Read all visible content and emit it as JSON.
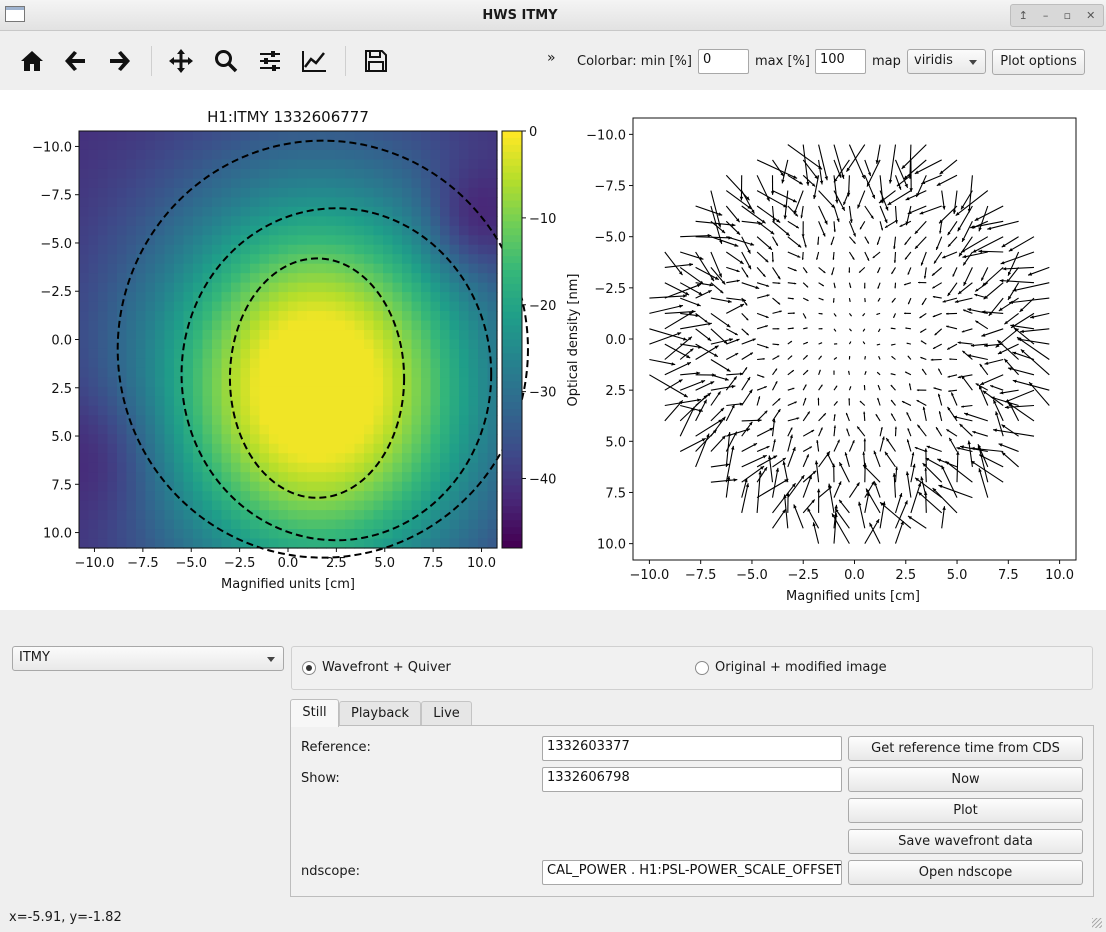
{
  "window": {
    "title": "HWS ITMY",
    "controls": [
      "↥",
      "–",
      "▫",
      "✕"
    ]
  },
  "toolbar": {
    "tools": [
      "home",
      "back",
      "forward",
      "pan",
      "zoom",
      "configure",
      "edit-axes",
      "save"
    ],
    "overflow": "»",
    "colorbar_min_label": "Colorbar: min [%]",
    "colorbar_min_value": "0",
    "colorbar_max_label": "max [%]",
    "colorbar_max_value": "100",
    "map_label": "map",
    "map_value": "viridis",
    "plot_options_label": "Plot options"
  },
  "left_plot": {
    "title": "H1:ITMY 1332606777",
    "xlabel": "Magnified units [cm]",
    "colorbar_label": "Optical density [nm]",
    "xticks": [
      "−10.0",
      "−7.5",
      "−5.0",
      "−2.5",
      "0.0",
      "2.5",
      "5.0",
      "7.5",
      "10.0"
    ],
    "yticks": [
      "10.0",
      "7.5",
      "5.0",
      "2.5",
      "0.0",
      "−2.5",
      "−5.0",
      "−7.5",
      "−10.0"
    ],
    "colorbar_ticks": [
      "0",
      "−10",
      "−20",
      "−30",
      "−40"
    ]
  },
  "right_plot": {
    "xlabel": "Magnified units [cm]",
    "xticks": [
      "−10.0",
      "−7.5",
      "−5.0",
      "−2.5",
      "0.0",
      "2.5",
      "5.0",
      "7.5",
      "10.0"
    ],
    "yticks": [
      "10.0",
      "7.5",
      "5.0",
      "2.5",
      "0.0",
      "−2.5",
      "−5.0",
      "−7.5",
      "−10.0"
    ]
  },
  "chart_data": [
    {
      "type": "heatmap",
      "title": "H1:ITMY 1332606777",
      "xlabel": "Magnified units [cm]",
      "ylabel": "",
      "xlim": [
        -10.8,
        10.8
      ],
      "ylim": [
        -10.8,
        10.8
      ],
      "colorbar_label": "Optical density [nm]",
      "colorbar_range": [
        -48,
        0
      ],
      "colormap": "viridis",
      "contours": "dashed black"
    },
    {
      "type": "scatter",
      "subtype": "quiver",
      "xlabel": "Magnified units [cm]",
      "ylabel": "",
      "xlim": [
        -10.8,
        10.8
      ],
      "ylim": [
        -10.8,
        10.8
      ]
    }
  ],
  "sensor_select": {
    "value": "ITMY"
  },
  "mode": {
    "option1": "Wavefront + Quiver",
    "option2": "Original + modified image",
    "selected": 1
  },
  "tabs": [
    "Still",
    "Playback",
    "Live"
  ],
  "form": {
    "reference_label": "Reference:",
    "reference_value": "1332603377",
    "show_label": "Show:",
    "show_value": "1332606798",
    "ndscope_label": "ndscope:",
    "ndscope_value": "CAL_POWER . H1:PSL-POWER_SCALE_OFFSET"
  },
  "buttons": {
    "get_ref": "Get reference time from CDS",
    "now": "Now",
    "plot": "Plot",
    "save": "Save wavefront data",
    "open_ndscope": "Open ndscope"
  },
  "status": {
    "coords": "x=-5.91, y=-1.82"
  }
}
